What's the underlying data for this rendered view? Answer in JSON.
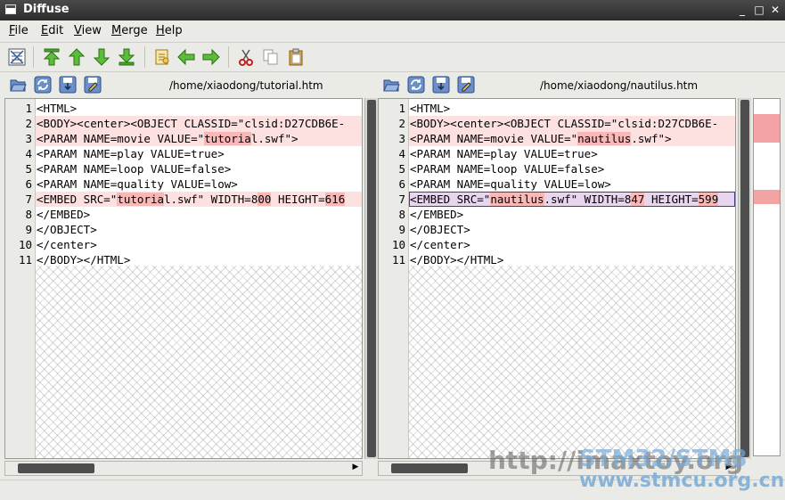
{
  "window": {
    "title": "Diffuse",
    "minimize": "_",
    "maximize": "□",
    "close": "✕"
  },
  "menu": [
    {
      "label_u": "F",
      "label_rest": "ile"
    },
    {
      "label_u": "E",
      "label_rest": "dit"
    },
    {
      "label_u": "V",
      "label_rest": "iew"
    },
    {
      "label_u": "M",
      "label_rest": "erge"
    },
    {
      "label_u": "H",
      "label_rest": "elp"
    }
  ],
  "left": {
    "path": "/home/xiaodong/tutorial.htm",
    "lines": [
      {
        "no": "1",
        "parts": [
          {
            "t": "<HTML>"
          }
        ]
      },
      {
        "no": "2",
        "parts": [
          {
            "t": "<BODY><center><OBJECT CLASSID=\"clsid:D27CDB6E-"
          }
        ]
      },
      {
        "no": "3",
        "parts": [
          {
            "t": "<PARAM NAME=movie VALUE=\""
          },
          {
            "t": "tutoria",
            "hl": true
          },
          {
            "t": "l.swf\">"
          }
        ]
      },
      {
        "no": "4",
        "parts": [
          {
            "t": "<PARAM NAME=play VALUE=true>"
          }
        ]
      },
      {
        "no": "5",
        "parts": [
          {
            "t": "<PARAM NAME=loop VALUE=false>"
          }
        ]
      },
      {
        "no": "6",
        "parts": [
          {
            "t": "<PARAM NAME=quality VALUE=low>"
          }
        ]
      },
      {
        "no": "7",
        "parts": [
          {
            "t": "<EMBED SRC=\""
          },
          {
            "t": "tutoria",
            "hl": true
          },
          {
            "t": "l.swf\" WIDTH=8"
          },
          {
            "t": "00",
            "hl": true
          },
          {
            "t": " HEIGHT="
          },
          {
            "t": "616",
            "hl": true
          }
        ]
      },
      {
        "no": "8",
        "parts": [
          {
            "t": "</EMBED>"
          }
        ]
      },
      {
        "no": "9",
        "parts": [
          {
            "t": "</OBJECT>"
          }
        ]
      },
      {
        "no": "10",
        "parts": [
          {
            "t": "</center>"
          }
        ]
      },
      {
        "no": "11",
        "parts": [
          {
            "t": "</BODY></HTML>"
          }
        ]
      }
    ]
  },
  "right": {
    "path": "/home/xiaodong/nautilus.htm",
    "lines": [
      {
        "no": "1",
        "parts": [
          {
            "t": "<HTML>"
          }
        ]
      },
      {
        "no": "2",
        "parts": [
          {
            "t": "<BODY><center><OBJECT CLASSID=\"clsid:D27CDB6E-"
          }
        ]
      },
      {
        "no": "3",
        "parts": [
          {
            "t": "<PARAM NAME=movie VALUE=\""
          },
          {
            "t": "nautilus",
            "hl": true
          },
          {
            "t": ".swf\">"
          }
        ]
      },
      {
        "no": "4",
        "parts": [
          {
            "t": "<PARAM NAME=play VALUE=true>"
          }
        ]
      },
      {
        "no": "5",
        "parts": [
          {
            "t": "<PARAM NAME=loop VALUE=false>"
          }
        ]
      },
      {
        "no": "6",
        "parts": [
          {
            "t": "<PARAM NAME=quality VALUE=low>"
          }
        ]
      },
      {
        "no": "7",
        "parts": [
          {
            "t": "<EMBED SRC=\""
          },
          {
            "t": "nautilus",
            "hl": true
          },
          {
            "t": ".swf\" WIDTH=8"
          },
          {
            "t": "47",
            "hl": true
          },
          {
            "t": " HEIGHT="
          },
          {
            "t": "599",
            "hl": true
          }
        ]
      },
      {
        "no": "8",
        "parts": [
          {
            "t": "</EMBED>"
          }
        ]
      },
      {
        "no": "9",
        "parts": [
          {
            "t": "</OBJECT>"
          }
        ]
      },
      {
        "no": "10",
        "parts": [
          {
            "t": "</center>"
          }
        ]
      },
      {
        "no": "11",
        "parts": [
          {
            "t": "</BODY></HTML>"
          }
        ]
      }
    ]
  },
  "diff_lines": [
    2,
    3,
    7
  ],
  "selected_line": 7,
  "watermark": {
    "line1": "http://imaxtoy.org",
    "line2": "STM32/STM8",
    "line3": "www.stmcu.org.cn"
  },
  "colors": {
    "diff_bg": "#fde1e1",
    "diff_hl": "#f8b8b8",
    "selection": "#e8d6ee",
    "overview_mark": "#f3a3a3"
  }
}
